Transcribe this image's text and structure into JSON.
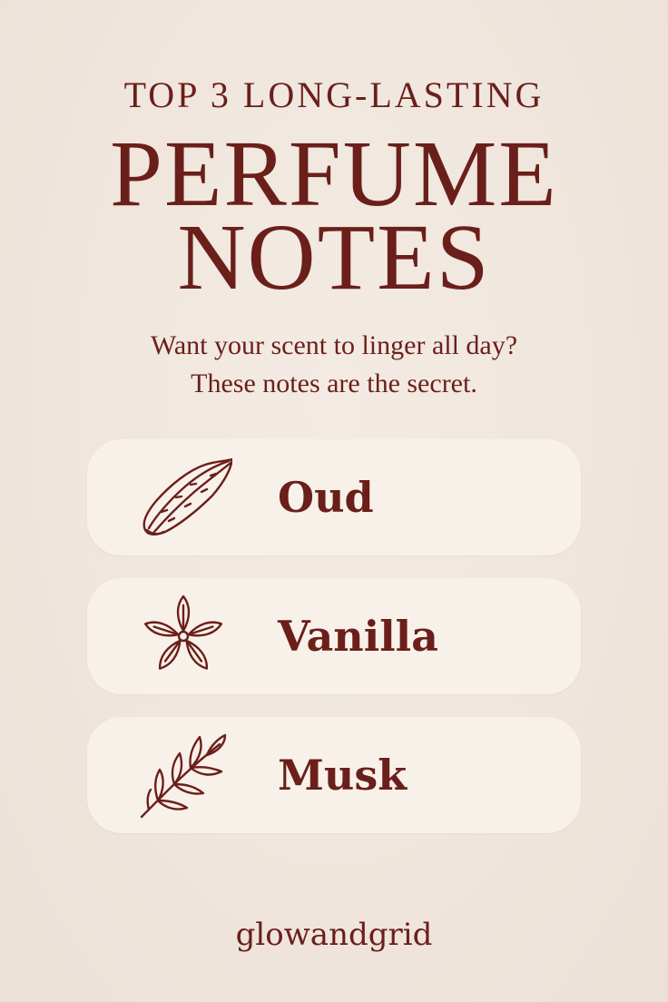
{
  "header": {
    "kicker": "TOP 3 LONG-LASTING",
    "title_line1": "PERFUME",
    "title_line2": "NOTES",
    "subtitle_line1": "Want your scent to linger all day?",
    "subtitle_line2": "These notes are the secret."
  },
  "notes": [
    {
      "label": "Oud",
      "icon": "wood-chip-icon"
    },
    {
      "label": "Vanilla",
      "icon": "vanilla-flower-icon"
    },
    {
      "label": "Musk",
      "icon": "herb-sprig-icon"
    }
  ],
  "footer": {
    "brand": "glowandgrid"
  },
  "colors": {
    "background": "#f0e6dd",
    "card": "#f8f1e9",
    "text": "#6b1f1a"
  }
}
